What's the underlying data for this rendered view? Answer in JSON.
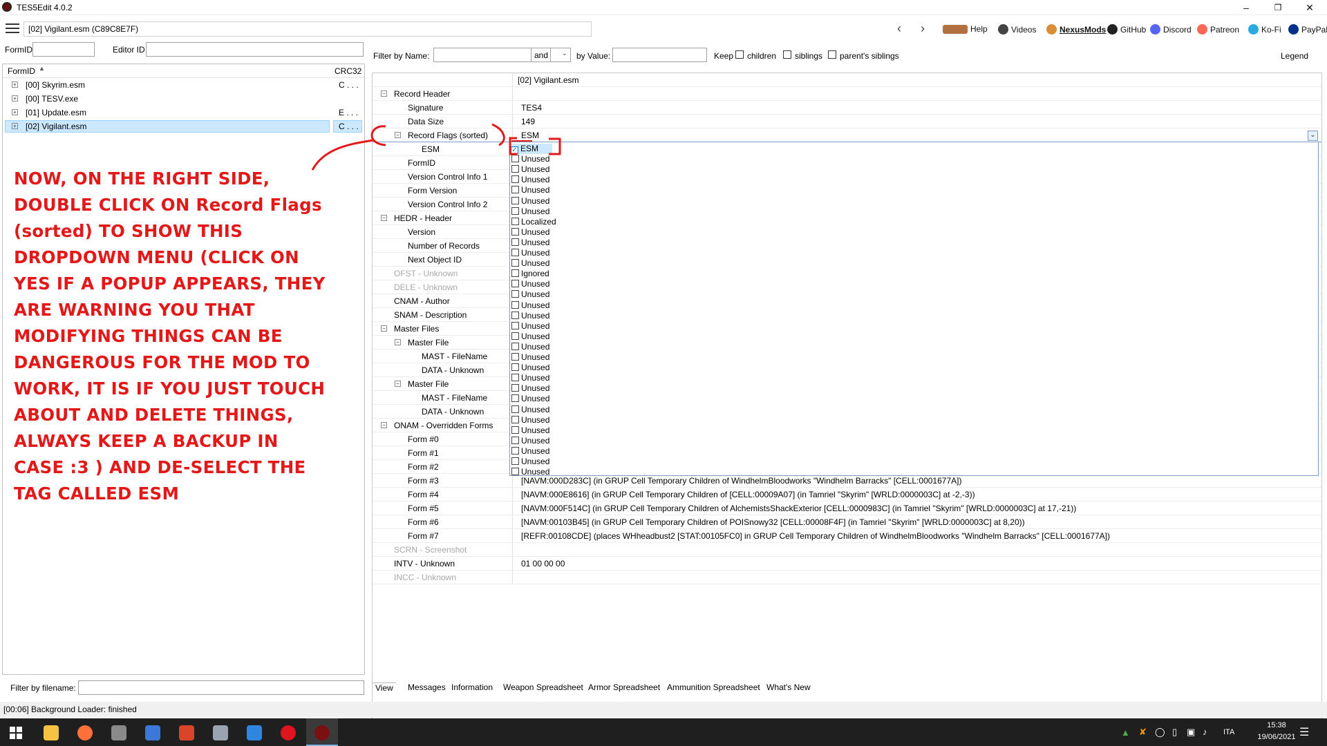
{
  "window": {
    "title": "TES5Edit 4.0.2"
  },
  "toolbar": {
    "path": "[02] Vigilant.esm (C89C8E7F)",
    "links": [
      {
        "label": "Help",
        "icon": "book-icon",
        "color": "#b07040"
      },
      {
        "label": "Videos",
        "icon": "video-icon",
        "color": "#444444"
      },
      {
        "label": "NexusMods",
        "icon": "nexus-icon",
        "color": "#da8e35"
      },
      {
        "label": "GitHub",
        "icon": "github-icon",
        "color": "#222222"
      },
      {
        "label": "Discord",
        "icon": "discord-icon",
        "color": "#5865f2"
      },
      {
        "label": "Patreon",
        "icon": "patreon-icon",
        "color": "#f96854"
      },
      {
        "label": "Ko-Fi",
        "icon": "kofi-icon",
        "color": "#29abe0"
      },
      {
        "label": "PayPal",
        "icon": "paypal-icon",
        "color": "#003087"
      }
    ]
  },
  "left": {
    "formid_label": "FormID",
    "editorid_label": "Editor ID",
    "col_formid": "FormID",
    "col_crc": "CRC32",
    "files": [
      {
        "name": "[00] Skyrim.esm",
        "crc": "C . . .",
        "selected": false
      },
      {
        "name": "[00] TESV.exe",
        "crc": "",
        "selected": false
      },
      {
        "name": "[01] Update.esm",
        "crc": "E . . .",
        "selected": false
      },
      {
        "name": "[02] Vigilant.esm",
        "crc": "C . . .",
        "selected": true
      }
    ],
    "filter_label": "Filter by filename:"
  },
  "annotation": {
    "text": "NOW, ON THE RIGHT SIDE,\nDOUBLE CLICK ON  Record Flags\n(sorted)  TO SHOW THIS\nDROPDOWN MENU (CLICK ON\nYES IF A POPUP APPEARS, THEY\nARE WARNING YOU THAT\nMODIFYING THINGS CAN BE\nDANGEROUS FOR THE MOD TO\nWORK, IT IS IF YOU JUST TOUCH\nABOUT AND DELETE THINGS,\nALWAYS KEEP A BACKUP IN\nCASE :3 ) AND DE-SELECT THE\nTAG CALLED    ESM",
    "color": "#e31818"
  },
  "filter": {
    "by_name_label": "Filter by Name:",
    "operator": "and",
    "by_value_label": "by Value:",
    "keep_label": "Keep",
    "children_label": "children",
    "siblings_label": "siblings",
    "parents_label": "parent's siblings",
    "legend_label": "Legend"
  },
  "tree": {
    "column_header": "[02] Vigilant.esm",
    "rows": [
      {
        "name": "Record Header",
        "value": "",
        "level": 0,
        "exp": "-",
        "dis": false
      },
      {
        "name": "Signature",
        "value": "TES4",
        "level": 1,
        "exp": "",
        "dis": false
      },
      {
        "name": "Data Size",
        "value": "149",
        "level": 1,
        "exp": "",
        "dis": false
      },
      {
        "name": "Record Flags (sorted)",
        "value": "ESM",
        "level": 1,
        "exp": "-",
        "dis": false
      },
      {
        "name": "ESM",
        "value": "",
        "level": 2,
        "exp": "",
        "dis": false
      },
      {
        "name": "FormID",
        "value": "",
        "level": 1,
        "exp": "",
        "dis": false
      },
      {
        "name": "Version Control Info 1",
        "value": "",
        "level": 1,
        "exp": "",
        "dis": false
      },
      {
        "name": "Form Version",
        "value": "",
        "level": 1,
        "exp": "",
        "dis": false
      },
      {
        "name": "Version Control Info 2",
        "value": "",
        "level": 1,
        "exp": "",
        "dis": false
      },
      {
        "name": "HEDR - Header",
        "value": "",
        "level": 0,
        "exp": "-",
        "dis": false
      },
      {
        "name": "Version",
        "value": "",
        "level": 1,
        "exp": "",
        "dis": false
      },
      {
        "name": "Number of Records",
        "value": "",
        "level": 1,
        "exp": "",
        "dis": false
      },
      {
        "name": "Next Object ID",
        "value": "",
        "level": 1,
        "exp": "",
        "dis": false
      },
      {
        "name": "OFST - Unknown",
        "value": "",
        "level": 0,
        "exp": "",
        "dis": true
      },
      {
        "name": "DELE - Unknown",
        "value": "",
        "level": 0,
        "exp": "",
        "dis": true
      },
      {
        "name": "CNAM - Author",
        "value": "",
        "level": 0,
        "exp": "",
        "dis": false
      },
      {
        "name": "SNAM - Description",
        "value": "",
        "level": 0,
        "exp": "",
        "dis": false
      },
      {
        "name": "Master Files",
        "value": "",
        "level": 0,
        "exp": "-",
        "dis": false
      },
      {
        "name": "Master File",
        "value": "",
        "level": 1,
        "exp": "-",
        "dis": false
      },
      {
        "name": "MAST - FileName",
        "value": "",
        "level": 2,
        "exp": "",
        "dis": false
      },
      {
        "name": "DATA - Unknown",
        "value": "",
        "level": 2,
        "exp": "",
        "dis": false
      },
      {
        "name": "Master File",
        "value": "",
        "level": 1,
        "exp": "-",
        "dis": false
      },
      {
        "name": "MAST - FileName",
        "value": "",
        "level": 2,
        "exp": "",
        "dis": false
      },
      {
        "name": "DATA - Unknown",
        "value": "",
        "level": 2,
        "exp": "",
        "dis": false
      },
      {
        "name": "ONAM - Overridden Forms",
        "value": "",
        "level": 0,
        "exp": "-",
        "dis": false
      },
      {
        "name": "Form #0",
        "value": "",
        "level": 1,
        "exp": "",
        "dis": false
      },
      {
        "name": "Form #1",
        "value": "",
        "level": 1,
        "exp": "",
        "dis": false
      },
      {
        "name": "Form #2",
        "value": "",
        "level": 1,
        "exp": "",
        "dis": false
      },
      {
        "name": "Form #3",
        "value": "[NAVM:000D283C] (in GRUP Cell Temporary Children of WindhelmBloodworks \"Windhelm Barracks\" [CELL:0001677A])",
        "level": 1,
        "exp": "",
        "dis": false
      },
      {
        "name": "Form #4",
        "value": "[NAVM:000E8616] (in GRUP Cell Temporary Children of [CELL:00009A07] (in Tamriel \"Skyrim\" [WRLD:0000003C] at -2,-3))",
        "level": 1,
        "exp": "",
        "dis": false
      },
      {
        "name": "Form #5",
        "value": "[NAVM:000F514C] (in GRUP Cell Temporary Children of AlchemistsShackExterior [CELL:0000983C] (in Tamriel \"Skyrim\" [WRLD:0000003C] at 17,-21))",
        "level": 1,
        "exp": "",
        "dis": false
      },
      {
        "name": "Form #6",
        "value": "[NAVM:00103B45] (in GRUP Cell Temporary Children of POISnowy32 [CELL:00008F4F] (in Tamriel \"Skyrim\" [WRLD:0000003C] at 8,20))",
        "level": 1,
        "exp": "",
        "dis": false
      },
      {
        "name": "Form #7",
        "value": "[REFR:00108CDE] (places WHheadbust2 [STAT:00105FC0] in GRUP Cell Temporary Children of WindhelmBloodworks \"Windhelm Barracks\" [CELL:0001677A])",
        "level": 1,
        "exp": "",
        "dis": false
      },
      {
        "name": "SCRN - Screenshot",
        "value": "",
        "level": 0,
        "exp": "",
        "dis": true
      },
      {
        "name": "INTV - Unknown",
        "value": "01 00 00 00",
        "level": 0,
        "exp": "",
        "dis": false
      },
      {
        "name": "INCC - Unknown",
        "value": "",
        "level": 0,
        "exp": "",
        "dis": true
      }
    ]
  },
  "flags": [
    {
      "label": "ESM",
      "checked": true
    },
    {
      "label": "Unused",
      "checked": false
    },
    {
      "label": "Unused",
      "checked": false
    },
    {
      "label": "Unused",
      "checked": false
    },
    {
      "label": "Unused",
      "checked": false
    },
    {
      "label": "Unused",
      "checked": false
    },
    {
      "label": "Unused",
      "checked": false
    },
    {
      "label": "Localized",
      "checked": false
    },
    {
      "label": "Unused",
      "checked": false
    },
    {
      "label": "Unused",
      "checked": false
    },
    {
      "label": "Unused",
      "checked": false
    },
    {
      "label": "Unused",
      "checked": false
    },
    {
      "label": "Ignored",
      "checked": false
    },
    {
      "label": "Unused",
      "checked": false
    },
    {
      "label": "Unused",
      "checked": false
    },
    {
      "label": "Unused",
      "checked": false
    },
    {
      "label": "Unused",
      "checked": false
    },
    {
      "label": "Unused",
      "checked": false
    },
    {
      "label": "Unused",
      "checked": false
    },
    {
      "label": "Unused",
      "checked": false
    },
    {
      "label": "Unused",
      "checked": false
    },
    {
      "label": "Unused",
      "checked": false
    },
    {
      "label": "Unused",
      "checked": false
    },
    {
      "label": "Unused",
      "checked": false
    },
    {
      "label": "Unused",
      "checked": false
    },
    {
      "label": "Unused",
      "checked": false
    },
    {
      "label": "Unused",
      "checked": false
    },
    {
      "label": "Unused",
      "checked": false
    },
    {
      "label": "Unused",
      "checked": false
    },
    {
      "label": "Unused",
      "checked": false
    },
    {
      "label": "Unused",
      "checked": false
    },
    {
      "label": "Unused",
      "checked": false
    }
  ],
  "tabs": [
    "View",
    "Messages",
    "Information",
    "Weapon Spreadsheet",
    "Armor Spreadsheet",
    "Ammunition Spreadsheet",
    "What's New"
  ],
  "status": "[00:06] Background Loader: finished",
  "taskbar": {
    "icons": [
      {
        "name": "file-explorer-icon",
        "color": "#f5c242"
      },
      {
        "name": "firefox-icon",
        "color": "#ff7139"
      },
      {
        "name": "app-icon-1",
        "color": "#8a8a8a"
      },
      {
        "name": "app-icon-2",
        "color": "#3b78d8"
      },
      {
        "name": "app-icon-3",
        "color": "#d9442b"
      },
      {
        "name": "app-icon-4",
        "color": "#9aa4b0"
      },
      {
        "name": "app-icon-5",
        "color": "#2e86de"
      },
      {
        "name": "opera-icon",
        "color": "#e0141e"
      },
      {
        "name": "tes5edit-icon",
        "color": "#7a1010"
      }
    ],
    "lang": "ITA",
    "time": "15:38",
    "date": "19/06/2021"
  }
}
